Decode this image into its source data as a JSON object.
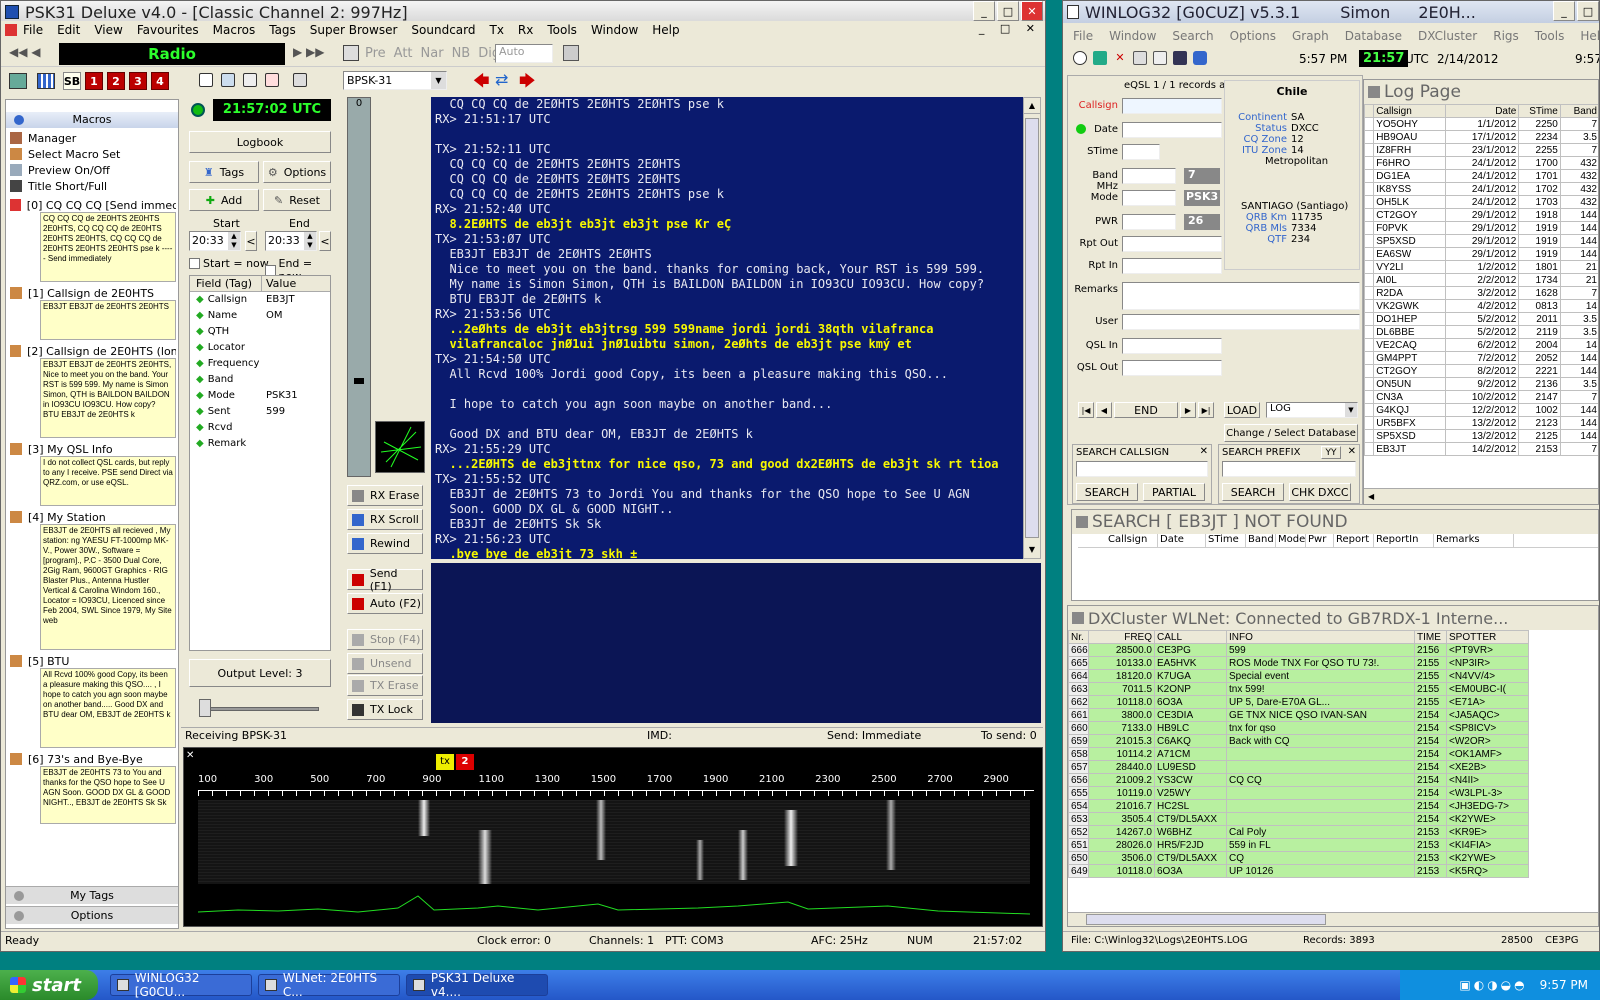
{
  "psk": {
    "title": "PSK31 Deluxe v4.0 - [Classic Channel 2: 997Hz]",
    "menus": [
      "File",
      "Edit",
      "View",
      "Favourites",
      "Macros",
      "Tags",
      "Super Browser",
      "Soundcard",
      "Tx",
      "Rx",
      "Tools",
      "Window",
      "Help"
    ],
    "radio_label": "Radio",
    "tb_buttons": [
      "SB",
      "1",
      "2",
      "3",
      "4"
    ],
    "toolbar_items": [
      "Pre",
      "Att",
      "Nar",
      "NB",
      "Dig"
    ],
    "mode_select": "BPSK-31",
    "auto_select": "Auto",
    "macros_header": "Macros",
    "macro_items": [
      "Manager",
      "Select Macro Set",
      "Preview On/Off",
      "Title Short/Full"
    ],
    "macros": [
      {
        "title": "[0] CQ CQ CQ [Send immedi...",
        "body": "CQ CQ CQ de 2E0HTS 2E0HTS 2E0HTS, CQ CQ CQ de 2E0HTS 2E0HTS 2E0HTS, CQ CQ CQ de 2E0HTS 2E0HTS 2E0HTS pse k ----- Send immediately"
      },
      {
        "title": "[1] Callsign de 2E0HTS",
        "body": "EB3JT EB3JT de 2E0HTS 2E0HTS"
      },
      {
        "title": "[2] Callsign de 2E0HTS (lon...",
        "body": "EB3JT EB3JT de 2E0HTS 2E0HTS, Nice to meet you on the band. Your RST is 599 599. My name is Simon Simon, QTH is BAILDON BAILDON in IO93CU IO93CU. How copy? BTU EB3JT de 2E0HTS k"
      },
      {
        "title": "[3] My QSL Info",
        "body": "I do not collect QSL cards, but reply to any I receive. PSE send Direct via QRZ.com, or use eQSL."
      },
      {
        "title": "[4] My Station",
        "body": "EB3JT de 2E0HTS all recieved , My station: ng YAESU FT-1000mp MK-V., Power 30W., Software = [program]., P.C - 3500 Dual Core, 2Gig Ram, 9600GT Graphics - RIG Blaster Plus., Antenna Hustler Vertical & Carolina Windom 160., Locator = IO93CU, Licenced since Feb 2004, SWL Since 1979, My Site web"
      },
      {
        "title": "[5] BTU",
        "body": "All Rcvd 100% good Copy, its been a pleasure making this QSO.... , I hope to catch you agn soon maybe on another band..... Good DX and BTU dear OM, EB3JT de 2E0HTS k"
      },
      {
        "title": "[6] 73's and Bye-Bye",
        "body": "EB3JT de 2E0HTS 73 to You and thanks for the QSO hope to See U AGN Soon. GOOD DX GL & GOOD NIGHT.., EB3JT de 2E0HTS Sk Sk"
      }
    ],
    "my_tags": "My Tags",
    "options": "Options",
    "utc_clock": "21:57:02 UTC",
    "logbook": "Logbook",
    "tags_btn": "Tags",
    "options_btn": "Options",
    "add_btn": "Add",
    "reset_btn": "Reset",
    "start_label": "Start",
    "end_label": "End",
    "start_time": "20:33",
    "end_time": "20:33",
    "start_now": "Start = now",
    "end_now": "End = now",
    "field_header": "Field (Tag)",
    "value_header": "Value",
    "fields": [
      {
        "f": "Callsign",
        "v": "EB3JT"
      },
      {
        "f": "Name",
        "v": "OM"
      },
      {
        "f": "QTH",
        "v": ""
      },
      {
        "f": "Locator",
        "v": ""
      },
      {
        "f": "Frequency",
        "v": ""
      },
      {
        "f": "Band",
        "v": ""
      },
      {
        "f": "Mode",
        "v": "PSK31"
      },
      {
        "f": "Sent",
        "v": "599"
      },
      {
        "f": "Rcvd",
        "v": ""
      },
      {
        "f": "Remark",
        "v": ""
      }
    ],
    "output_level": "Output Level: 3",
    "level_top": "0",
    "side_buttons": [
      "RX Erase",
      "RX Scroll",
      "Rewind",
      "Send (F1)",
      "Auto (F2)",
      "Stop (F4)",
      "Unsend",
      "TX Erase",
      "TX Lock"
    ],
    "rx_lines": [
      {
        "c": "wht",
        "t": "  CQ CQ CQ de 2EØHTS 2EØHTS 2EØHTS pse k"
      },
      {
        "c": "wht",
        "t": "RX> 21:51:17 UTC"
      },
      {
        "c": "wht",
        "t": ""
      },
      {
        "c": "wht",
        "t": "TX> 21:52:11 UTC"
      },
      {
        "c": "wht",
        "t": "  CQ CQ CQ de 2EØHTS 2EØHTS 2EØHTS"
      },
      {
        "c": "wht",
        "t": "  CQ CQ CQ de 2EØHTS 2EØHTS 2EØHTS"
      },
      {
        "c": "wht",
        "t": "  CQ CQ CQ de 2EØHTS 2EØHTS 2EØHTS pse k"
      },
      {
        "c": "wht",
        "t": "RX> 21:52:4Ø UTC"
      },
      {
        "c": "yel",
        "t": "  8.2EØHTS de eb3jt eb3jt eb3jt pse Kr eÇ"
      },
      {
        "c": "wht",
        "t": "TX> 21:53:Ø7 UTC"
      },
      {
        "c": "wht",
        "t": "  EB3JT EB3JT de 2EØHTS 2EØHTS"
      },
      {
        "c": "wht",
        "t": "  Nice to meet you on the band. thanks for coming back, Your RST is 599 599."
      },
      {
        "c": "wht",
        "t": "  My name is Simon Simon, QTH is BAILDON BAILDON in IO93CU IO93CU. How copy?"
      },
      {
        "c": "wht",
        "t": "  BTU EB3JT de 2EØHTS k"
      },
      {
        "c": "wht",
        "t": "RX> 21:53:56 UTC"
      },
      {
        "c": "yel",
        "t": "  ..2eØhts de eb3jt eb3jtrsg 599 599name jordi jordi 38qth vilafranca"
      },
      {
        "c": "yel",
        "t": "  vilafrancaloc jnØ1ui jnØ1uibtu simon, 2eØhts de eb3jt pse kmý et"
      },
      {
        "c": "wht",
        "t": "TX> 21:54:5Ø UTC"
      },
      {
        "c": "wht",
        "t": "  All Rcvd 100% Jordi good Copy, its been a pleasure making this QSO..."
      },
      {
        "c": "wht",
        "t": ""
      },
      {
        "c": "wht",
        "t": "  I hope to catch you agn soon maybe on another band..."
      },
      {
        "c": "wht",
        "t": ""
      },
      {
        "c": "wht",
        "t": "  Good DX and BTU dear OM, EB3JT de 2EØHTS k"
      },
      {
        "c": "wht",
        "t": "RX> 21:55:29 UTC"
      },
      {
        "c": "yel",
        "t": "  ...2EØHTS de eb3jttnx for nice qso, 73 and good dx2EØHTS de eb3jt sk rt tioa"
      },
      {
        "c": "wht",
        "t": "TX> 21:55:52 UTC"
      },
      {
        "c": "wht",
        "t": "  EB3JT de 2EØHTS 73 to Jordi You and thanks for the QSO hope to See U AGN"
      },
      {
        "c": "wht",
        "t": "  Soon. GOOD DX GL & GOOD NIGHT.."
      },
      {
        "c": "wht",
        "t": "  EB3JT de 2EØHTS Sk Sk"
      },
      {
        "c": "wht",
        "t": "RX> 21:56:23 UTC"
      },
      {
        "c": "yel",
        "t": "  .bye bye de eb3jt 73 skh ±"
      }
    ],
    "status_receiving": "Receiving BPSK-31",
    "status_imd": "IMD:",
    "status_send": "Send: Immediate",
    "status_tosend": "To send: 0",
    "wf_freqs": [
      "100",
      "300",
      "500",
      "700",
      "900",
      "1100",
      "1300",
      "1500",
      "1700",
      "1900",
      "2100",
      "2300",
      "2500",
      "2700",
      "2900"
    ],
    "marker_tx": "tx",
    "marker_2": "2",
    "statusbar": {
      "ready": "Ready",
      "clock_err": "Clock error: 0",
      "channels": "Channels: 1",
      "ptt": "PTT: COM3",
      "afc": "AFC: 25Hz",
      "num": "NUM",
      "time": "21:57:02"
    }
  },
  "winlog": {
    "title": "WINLOG32 [G0CUZ]  v5.3.1",
    "title_name": "Simon",
    "title_call": "2E0H...",
    "menus": [
      "File",
      "Window",
      "Search",
      "Options",
      "Graph",
      "Database",
      "DXCluster",
      "Rigs",
      "Tools",
      "Help"
    ],
    "time_local": "5:57 PM",
    "utc_time": "21:57",
    "utc_label": "UTC",
    "date": "2/14/2012",
    "right_time": "9:57",
    "eqsl_msg": "eQSL 1 / 1 records added",
    "form_labels": [
      "Callsign",
      "Date",
      "STime",
      "Band MHz",
      "Mode",
      "PWR",
      "Rpt Out",
      "Rpt In",
      "Remarks",
      "User",
      "QSL In",
      "QSL Out"
    ],
    "band_val": "7",
    "mode_val": "PSK3",
    "pwr_val": "26",
    "country": "Chile",
    "info": [
      {
        "k": "Continent",
        "v": "SA"
      },
      {
        "k": "Status",
        "v": "DXCC"
      },
      {
        "k": "CQ Zone",
        "v": "12"
      },
      {
        "k": "ITU Zone",
        "v": "14"
      }
    ],
    "metro": "Metropolitan",
    "city": "SANTIAGO (Santiago)",
    "qrb": [
      {
        "k": "QRB Km",
        "v": "11735"
      },
      {
        "k": "QRB Mls",
        "v": "7334"
      },
      {
        "k": "QTF",
        "v": "234"
      }
    ],
    "nav_end": "END",
    "load_btn": "LOAD",
    "log_select": "LOG",
    "change_db": "Change / Select Database",
    "search_call_label": "SEARCH CALLSIGN",
    "search_prefix_label": "SEARCH PREFIX",
    "yy": "YY",
    "search_btn": "SEARCH",
    "partial_btn": "PARTIAL",
    "chk_dxcc": "CHK DXCC",
    "log_page_title": "Log Page",
    "log_cols": [
      "Callsign",
      "Date",
      "STime",
      "Band"
    ],
    "log_rows": [
      [
        "YO5OHY",
        "1/1/2012",
        "2250",
        "7"
      ],
      [
        "HB9OAU",
        "17/1/2012",
        "2234",
        "3.5"
      ],
      [
        "IZ8FRH",
        "23/1/2012",
        "2255",
        "7"
      ],
      [
        "F6HRO",
        "24/1/2012",
        "1700",
        "432"
      ],
      [
        "DG1EA",
        "24/1/2012",
        "1701",
        "432"
      ],
      [
        "IK8YSS",
        "24/1/2012",
        "1702",
        "432"
      ],
      [
        "OH5LK",
        "24/1/2012",
        "1703",
        "432"
      ],
      [
        "CT2GOY",
        "29/1/2012",
        "1918",
        "144"
      ],
      [
        "F0PVK",
        "29/1/2012",
        "1919",
        "144"
      ],
      [
        "SP5XSD",
        "29/1/2012",
        "1919",
        "144"
      ],
      [
        "EA6SW",
        "29/1/2012",
        "1919",
        "144"
      ],
      [
        "VY2LI",
        "1/2/2012",
        "1801",
        "21"
      ],
      [
        "AI0L",
        "2/2/2012",
        "1734",
        "21"
      ],
      [
        "R2DA",
        "3/2/2012",
        "1628",
        "7"
      ],
      [
        "VK2GWK",
        "4/2/2012",
        "0813",
        "14"
      ],
      [
        "DO1HEP",
        "5/2/2012",
        "2011",
        "3.5"
      ],
      [
        "DL6BBE",
        "5/2/2012",
        "2119",
        "3.5"
      ],
      [
        "VE2CAQ",
        "6/2/2012",
        "2004",
        "14"
      ],
      [
        "GM4PPT",
        "7/2/2012",
        "2052",
        "144"
      ],
      [
        "CT2GOY",
        "8/2/2012",
        "2221",
        "144"
      ],
      [
        "ON5UN",
        "9/2/2012",
        "2136",
        "3.5"
      ],
      [
        "CN3A",
        "10/2/2012",
        "2147",
        "7"
      ],
      [
        "G4KQJ",
        "12/2/2012",
        "1002",
        "144"
      ],
      [
        "UR5BFX",
        "13/2/2012",
        "2123",
        "144"
      ],
      [
        "SP5XSD",
        "13/2/2012",
        "2125",
        "144"
      ],
      [
        "EB3JT",
        "14/2/2012",
        "2153",
        "7"
      ]
    ],
    "search_result_title": "SEARCH [ EB3JT ] NOT FOUND",
    "search_cols": [
      "Callsign",
      "Date",
      "STime",
      "Band",
      "Mode",
      "Pwr",
      "Report",
      "ReportIn",
      "Remarks"
    ],
    "dx_title": "DXCluster WLNet: Connected to GB7RDX-1 Interne...",
    "dx_cols": [
      "Nr.",
      "FREQ",
      "CALL",
      "INFO",
      "TIME",
      "SPOTTER"
    ],
    "dx_rows": [
      [
        "666",
        "28500.0",
        "CE3PG",
        "599",
        "2156",
        "<PT9VR>"
      ],
      [
        "665",
        "10133.0",
        "EA5HVK",
        "ROS Mode TNX For QSO TU 73!.",
        "2155",
        "<NP3IR>"
      ],
      [
        "664",
        "18120.0",
        "K7UGA",
        "Special event",
        "2155",
        "<N4VV/4>"
      ],
      [
        "663",
        "7011.5",
        "K2ONP",
        "tnx 599!",
        "2155",
        "<EM0UBC-I("
      ],
      [
        "662",
        "10118.0",
        "6O3A",
        "UP 5, Dare-E70A GL...",
        "2155",
        "<E71A>"
      ],
      [
        "661",
        "3800.0",
        "CE3DIA",
        "GE TNX NICE QSO IVAN-SAN",
        "2154",
        "<JA5AQC>"
      ],
      [
        "660",
        "7133.0",
        "HB9LC",
        "tnx for qso",
        "2154",
        "<SP8ICV>"
      ],
      [
        "659",
        "21015.3",
        "C6AKQ",
        "Back with CQ",
        "2154",
        "<W2OR>"
      ],
      [
        "658",
        "10114.2",
        "A71CM",
        "",
        "2154",
        "<OK1AMF>"
      ],
      [
        "657",
        "28440.0",
        "LU9ESD",
        "",
        "2154",
        "<XE2B>"
      ],
      [
        "656",
        "21009.2",
        "YS3CW",
        "CQ CQ",
        "2154",
        "<N4II>"
      ],
      [
        "655",
        "10119.0",
        "V25WY",
        "",
        "2154",
        "<W3LPL-3>"
      ],
      [
        "654",
        "21016.7",
        "HC2SL",
        "",
        "2154",
        "<JH3EDG-7>"
      ],
      [
        "653",
        "3505.4",
        "CT9/DL5AXX",
        "",
        "2154",
        "<K2YWE>"
      ],
      [
        "652",
        "14267.0",
        "W6BHZ",
        "Cal Poly",
        "2153",
        "<KR9E>"
      ],
      [
        "651",
        "28026.0",
        "HR5/F2JD",
        "559 in FL",
        "2153",
        "<KI4FIA>"
      ],
      [
        "650",
        "3506.0",
        "CT9/DL5AXX",
        "CQ",
        "2153",
        "<K2YWE>"
      ],
      [
        "649",
        "10118.0",
        "6O3A",
        "UP 10126",
        "2153",
        "<K5RQ>"
      ]
    ],
    "status_file": "File: C:\\Winlog32\\Logs\\2E0HTS.LOG",
    "status_records": "Records: 3893",
    "status_freq": "28500",
    "status_call": "CE3PG"
  },
  "taskbar": {
    "start": "start",
    "tasks": [
      "WINLOG32 [G0CU...",
      "WLNet: 2E0HTS C...",
      "PSK31 Deluxe v4...."
    ],
    "clock": "9:57 PM"
  },
  "colors": {
    "rx_bg": "#0a1a6e",
    "tx_bg": "#0b1555",
    "yellow": "#f8f800",
    "dx_green": "#b8f0a0",
    "macro_bg": "#ffffc8"
  }
}
